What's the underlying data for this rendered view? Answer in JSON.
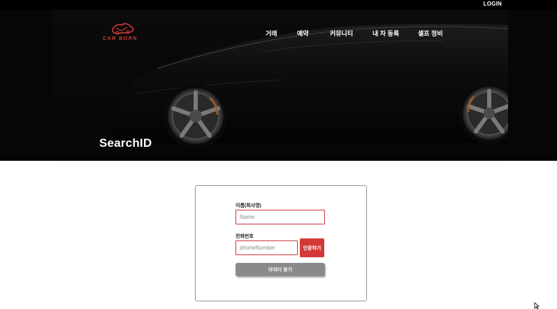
{
  "topbar": {
    "login_label": "LOGIN"
  },
  "header": {
    "logo_text": "CAR BORN",
    "nav": [
      {
        "label": "거래"
      },
      {
        "label": "예약"
      },
      {
        "label": "커뮤니티"
      },
      {
        "label": "내 차 등록"
      },
      {
        "label": "셀프 정비"
      }
    ],
    "hero_title": "SearchID"
  },
  "form": {
    "name_label": "이름(회사명)",
    "name_placeholder": "Name",
    "name_value": "",
    "phone_label": "전화번호",
    "phone_placeholder": "phoneNumber",
    "phone_value": "",
    "auth_button": "인증하기",
    "find_button": "아이디 찾기"
  },
  "colors": {
    "accent": "#d33a37",
    "hero_bg": "#060606",
    "find_button_bg": "#8a8a8a"
  }
}
